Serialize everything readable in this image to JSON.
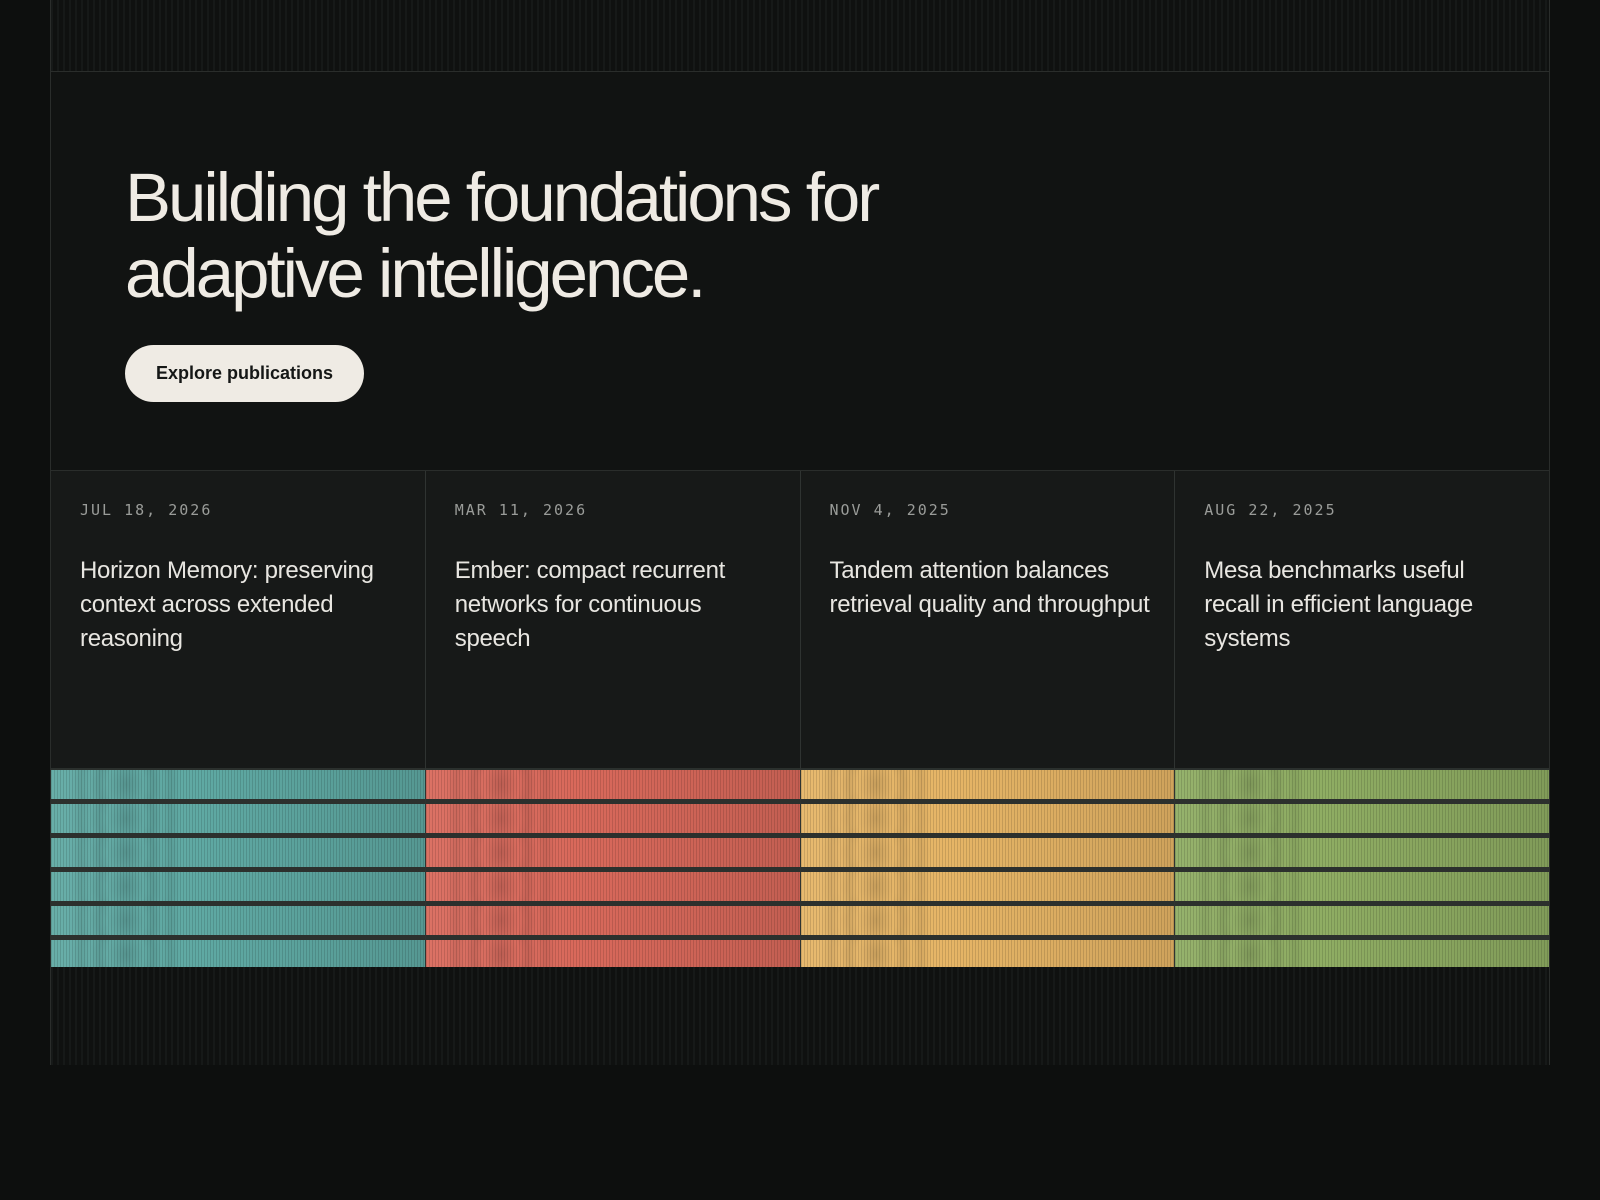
{
  "hero": {
    "headline_line1": "Building the foundations for",
    "headline_line2": "adaptive intelligence.",
    "cta_label": "Explore publications"
  },
  "cards": [
    {
      "date": "JUL 18, 2026",
      "title": "Horizon Memory: preserving context across extended reasoning",
      "color": "#5fa9a3"
    },
    {
      "date": "MAR 11, 2026",
      "title": "Ember: compact recurrent networks for continuous speech",
      "color": "#d9695b"
    },
    {
      "date": "NOV 4, 2025",
      "title": "Tandem attention balances retrieval quality and throughput",
      "color": "#e6b566"
    },
    {
      "date": "AUG 22, 2025",
      "title": "Mesa benchmarks useful recall in efficient language systems",
      "color": "#8fad63"
    }
  ]
}
